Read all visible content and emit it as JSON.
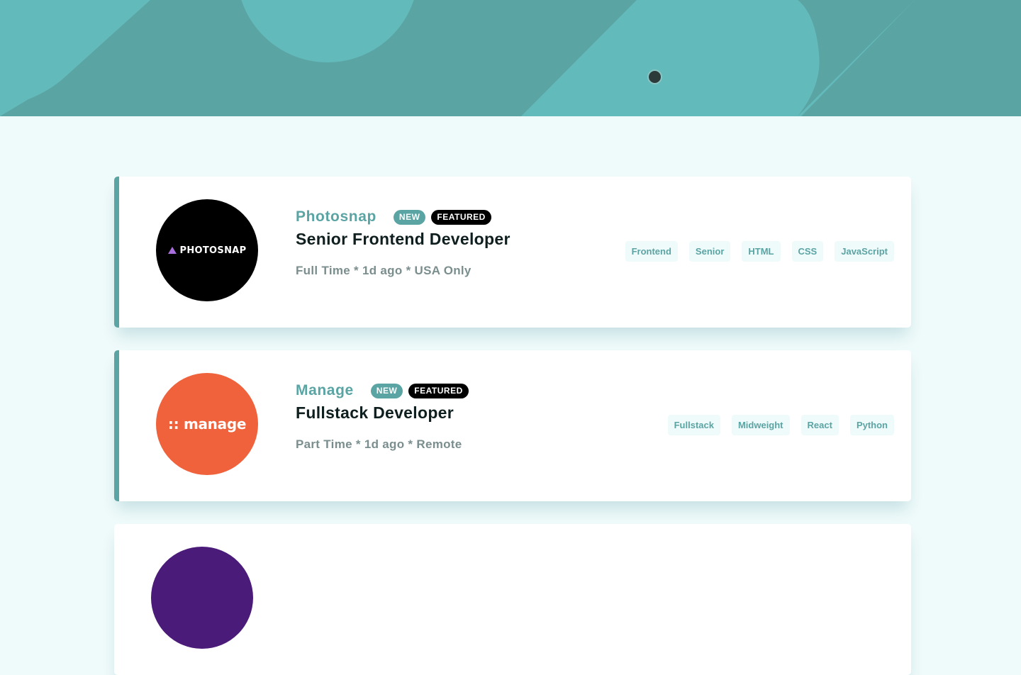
{
  "colors": {
    "accent": "#5ba4a4",
    "background": "#effafa",
    "featured_badge": "#000000",
    "photosnap_logo": "#000000",
    "manage_logo": "#ef623c"
  },
  "jobs": [
    {
      "logo_text": "PHOTOSNAP",
      "logo_icon": "triangle-icon",
      "company": "Photosnap",
      "new_label": "NEW",
      "featured_label": "FEATURED",
      "position": "Senior Frontend Developer",
      "meta": "Full Time * 1d ago * USA Only",
      "tags": [
        "Frontend",
        "Senior",
        "HTML",
        "CSS",
        "JavaScript"
      ]
    },
    {
      "logo_text": ":: manage",
      "company": "Manage",
      "new_label": "NEW",
      "featured_label": "FEATURED",
      "position": "Fullstack Developer",
      "meta": "Part Time * 1d ago * Remote",
      "tags": [
        "Fullstack",
        "Midweight",
        "React",
        "Python"
      ]
    }
  ]
}
